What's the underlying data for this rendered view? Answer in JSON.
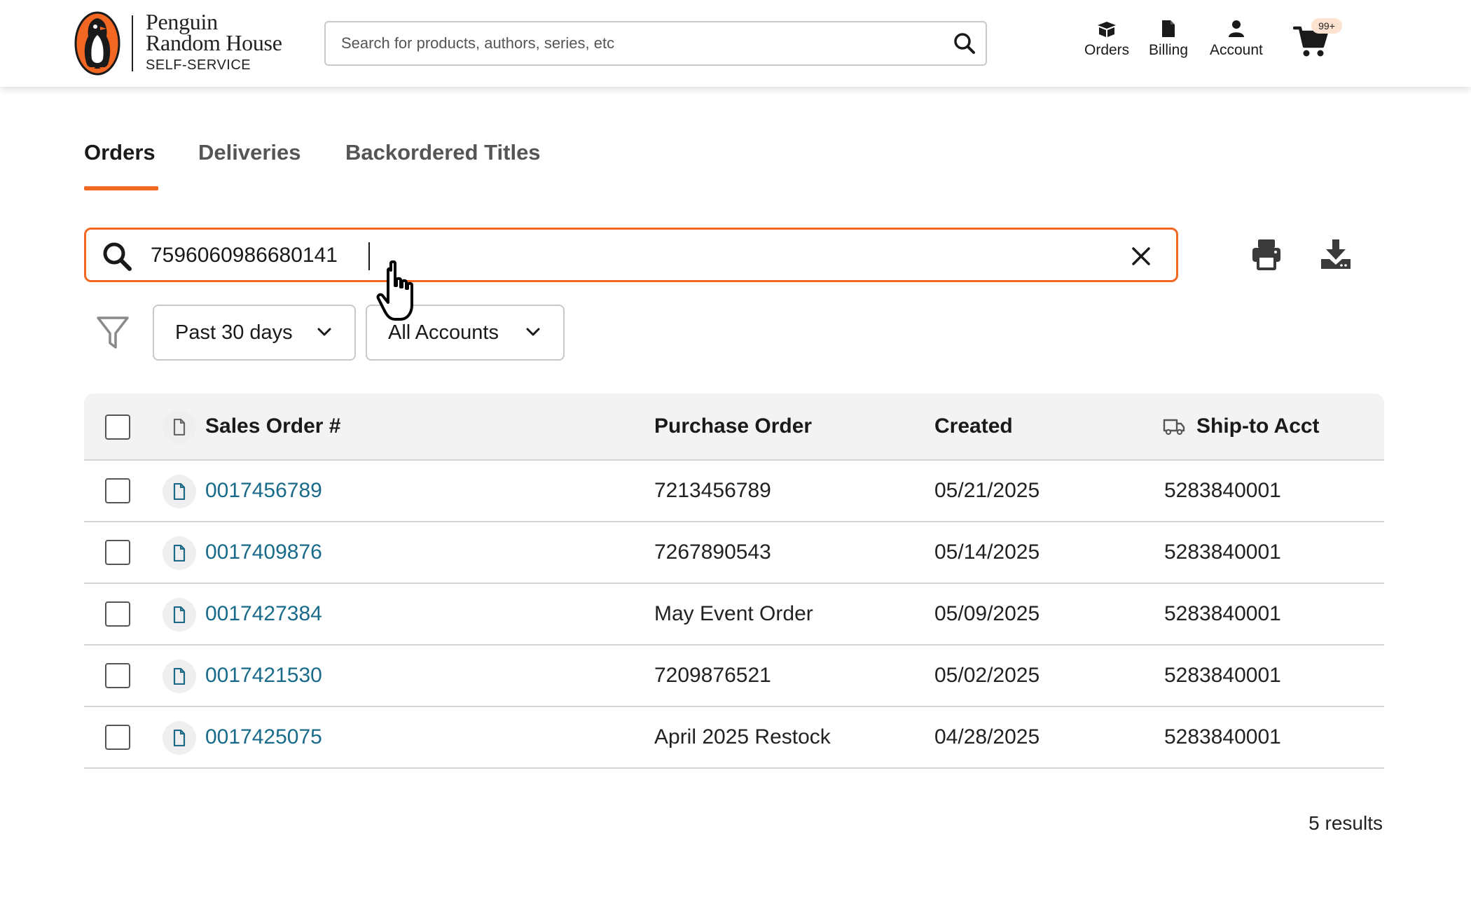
{
  "header": {
    "logo": {
      "line1": "Penguin",
      "line2": "Random House",
      "line3": "SELF-SERVICE"
    },
    "search_placeholder": "Search for products, authors, series, etc",
    "nav": [
      {
        "label": "Orders",
        "icon": "box-icon"
      },
      {
        "label": "Billing",
        "icon": "document-icon"
      },
      {
        "label": "Account",
        "icon": "person-icon"
      }
    ],
    "cart_badge": "99+",
    "colors": {
      "brand_orange": "#f26722",
      "link_blue": "#1a6a8a"
    }
  },
  "tabs": [
    {
      "label": "Orders",
      "active": true
    },
    {
      "label": "Deliveries",
      "active": false
    },
    {
      "label": "Backordered Titles",
      "active": false
    }
  ],
  "order_search": {
    "value": "7596060986680141"
  },
  "filters": {
    "date_range": "Past 30 days",
    "accounts": "All Accounts"
  },
  "table": {
    "columns": [
      "Sales Order #",
      "Purchase Order",
      "Created",
      "Ship-to Acct"
    ],
    "rows": [
      {
        "sales_order": "0017456789",
        "purchase_order": "7213456789",
        "created": "05/21/2025",
        "ship_to": "5283840001"
      },
      {
        "sales_order": "0017409876",
        "purchase_order": "7267890543",
        "created": "05/14/2025",
        "ship_to": "5283840001"
      },
      {
        "sales_order": "0017427384",
        "purchase_order": "May Event Order",
        "created": "05/09/2025",
        "ship_to": "5283840001"
      },
      {
        "sales_order": "0017421530",
        "purchase_order": "7209876521",
        "created": "05/02/2025",
        "ship_to": "5283840001"
      },
      {
        "sales_order": "0017425075",
        "purchase_order": "April 2025 Restock",
        "created": "04/28/2025",
        "ship_to": "5283840001"
      }
    ]
  },
  "results_text": "5 results"
}
